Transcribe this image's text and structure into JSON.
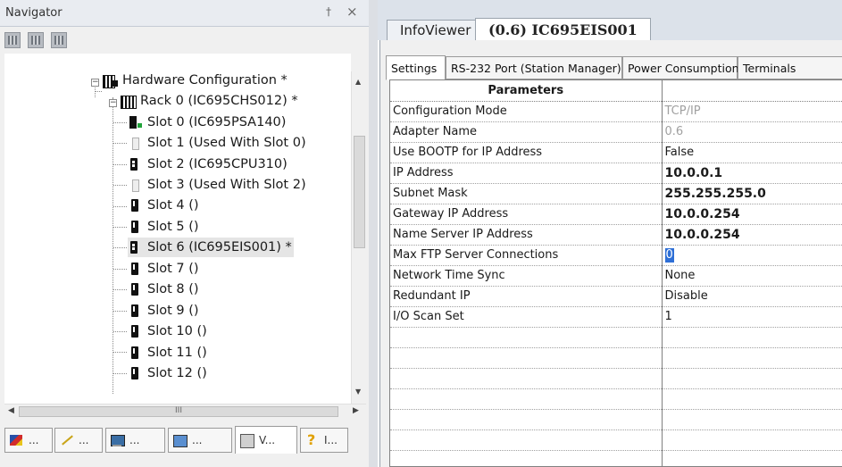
{
  "navigator": {
    "title": "Navigator",
    "pin_glyph": "†",
    "close_glyph": "×",
    "toolbar_icons": [
      "toolbar-icon-1",
      "toolbar-icon-2",
      "toolbar-icon-3"
    ],
    "tree": {
      "root": "Hardware Configuration *",
      "rack": "Rack 0 (IC695CHS012) *",
      "slots": [
        "Slot 0 (IC695PSA140)",
        "Slot 1 (Used With Slot 0)",
        "Slot 2 (IC695CPU310)",
        "Slot 3 (Used With Slot 2)",
        "Slot 4 ()",
        "Slot 5 ()",
        "Slot 6 (IC695EIS001) *",
        "Slot 7 ()",
        "Slot 8 ()",
        "Slot 9 ()",
        "Slot 10 ()",
        "Slot 11 ()",
        "Slot 12 ()"
      ]
    },
    "hscroll_grip": "III",
    "bottom_tabs": [
      {
        "label": "...",
        "icon": "project-icon"
      },
      {
        "label": "...",
        "icon": "wire-icon"
      },
      {
        "label": "...",
        "icon": "computer-icon"
      },
      {
        "label": "...",
        "icon": "network-icon"
      },
      {
        "label": "V...",
        "icon": "variables-icon"
      },
      {
        "label": "I...",
        "icon": "help-icon"
      }
    ]
  },
  "doc_tabs": {
    "inactive": "InfoViewer",
    "active": "(0.6) IC695EIS001"
  },
  "property_tabs": [
    "Settings",
    "RS-232 Port (Station Manager)",
    "Power Consumption",
    "Terminals"
  ],
  "grid": {
    "header": "Parameters",
    "rows": [
      {
        "name": "Configuration Mode",
        "value": "TCP/IP"
      },
      {
        "name": "Adapter Name",
        "value": "0.6"
      },
      {
        "name": "Use BOOTP for IP Address",
        "value": "False"
      },
      {
        "name": "IP Address",
        "value": "10.0.0.1"
      },
      {
        "name": "Subnet Mask",
        "value": "255.255.255.0"
      },
      {
        "name": "Gateway IP Address",
        "value": "10.0.0.254"
      },
      {
        "name": "Name Server IP Address",
        "value": "10.0.0.254"
      },
      {
        "name": "Max FTP Server Connections",
        "value": "0"
      },
      {
        "name": "Network Time Sync",
        "value": "None"
      },
      {
        "name": "Redundant IP",
        "value": "Disable"
      },
      {
        "name": "I/O Scan Set",
        "value": "1"
      }
    ]
  },
  "colors": {
    "selection": "#2e6fd6",
    "greyed_text": "#a0a0a0",
    "panel_bg": "#f0f0f0"
  }
}
